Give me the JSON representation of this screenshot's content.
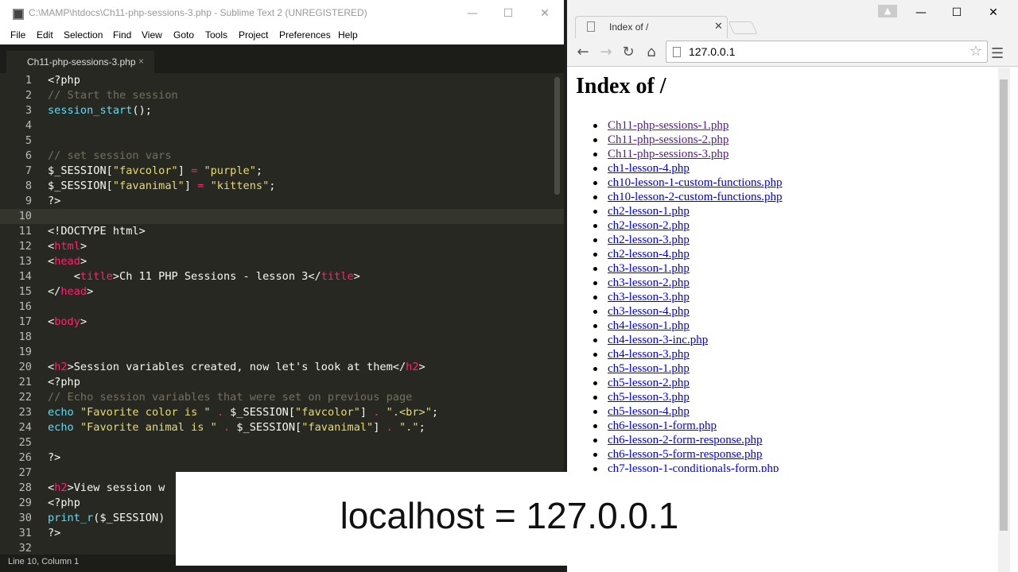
{
  "sublime": {
    "title": "C:\\MAMP\\htdocs\\Ch11-php-sessions-3.php - Sublime Text 2 (UNREGISTERED)",
    "menu": [
      "File",
      "Edit",
      "Selection",
      "Find",
      "View",
      "Goto",
      "Tools",
      "Project",
      "Preferences",
      "Help"
    ],
    "tab": "Ch11-php-sessions-3.php",
    "status": "Line 10, Column 1",
    "lines": [
      {
        "n": "1",
        "html": "&lt;?php"
      },
      {
        "n": "2",
        "html": "<span class=\"c\">// Start the session</span>"
      },
      {
        "n": "3",
        "html": "<span class=\"f\">session_start</span>();"
      },
      {
        "n": "4",
        "html": ""
      },
      {
        "n": "5",
        "html": ""
      },
      {
        "n": "6",
        "html": "<span class=\"c\">// set session vars</span>"
      },
      {
        "n": "7",
        "html": "$_SESSION[<span class=\"s\">\"favcolor\"</span>] <span class=\"k\">=</span> <span class=\"s\">\"purple\"</span>;"
      },
      {
        "n": "8",
        "html": "$_SESSION[<span class=\"s\">\"favanimal\"</span>] <span class=\"k\">=</span> <span class=\"s\">\"kittens\"</span>;"
      },
      {
        "n": "9",
        "html": "?&gt;"
      },
      {
        "n": "10",
        "html": ""
      },
      {
        "n": "11",
        "html": "&lt;!DOCTYPE html&gt;"
      },
      {
        "n": "12",
        "html": "&lt;<span class=\"k\">html</span>&gt;"
      },
      {
        "n": "13",
        "html": "&lt;<span class=\"k\">head</span>&gt;"
      },
      {
        "n": "14",
        "html": "    &lt;<span class=\"k\">title</span>&gt;Ch 11 PHP Sessions - lesson 3&lt;/<span class=\"k\">title</span>&gt;"
      },
      {
        "n": "15",
        "html": "&lt;/<span class=\"k\">head</span>&gt;"
      },
      {
        "n": "16",
        "html": ""
      },
      {
        "n": "17",
        "html": "&lt;<span class=\"k\">body</span>&gt;"
      },
      {
        "n": "18",
        "html": ""
      },
      {
        "n": "19",
        "html": ""
      },
      {
        "n": "20",
        "html": "&lt;<span class=\"k\">h2</span>&gt;Session variables created, now let's look at them&lt;/<span class=\"k\">h2</span>&gt;"
      },
      {
        "n": "21",
        "html": "&lt;?php"
      },
      {
        "n": "22",
        "html": "<span class=\"c\">// Echo session variables that were set on previous page</span>"
      },
      {
        "n": "23",
        "html": "<span class=\"f\">echo</span> <span class=\"s\">\"Favorite color is \"</span> <span class=\"k\">.</span> $_SESSION[<span class=\"s\">\"favcolor\"</span>] <span class=\"k\">.</span> <span class=\"s\">\".&lt;br&gt;\"</span>;"
      },
      {
        "n": "24",
        "html": "<span class=\"f\">echo</span> <span class=\"s\">\"Favorite animal is \"</span> <span class=\"k\">.</span> $_SESSION[<span class=\"s\">\"favanimal\"</span>] <span class=\"k\">.</span> <span class=\"s\">\".\"</span>;"
      },
      {
        "n": "25",
        "html": ""
      },
      {
        "n": "26",
        "html": "?&gt;"
      },
      {
        "n": "27",
        "html": ""
      },
      {
        "n": "28",
        "html": "&lt;<span class=\"k\">h2</span>&gt;View session w"
      },
      {
        "n": "29",
        "html": "&lt;?php"
      },
      {
        "n": "30",
        "html": "<span class=\"f\">print_r</span>($_SESSION)"
      },
      {
        "n": "31",
        "html": "?&gt;"
      },
      {
        "n": "32",
        "html": ""
      }
    ]
  },
  "chrome": {
    "tab": "Index of /",
    "url": "127.0.0.1",
    "heading": "Index of /",
    "links": [
      {
        "text": "Ch11-php-sessions-1.php",
        "visited": true
      },
      {
        "text": "Ch11-php-sessions-2.php",
        "visited": true
      },
      {
        "text": "Ch11-php-sessions-3.php",
        "visited": true
      },
      {
        "text": "ch1-lesson-4.php",
        "visited": false
      },
      {
        "text": "ch10-lesson-1-custom-functions.php",
        "visited": false
      },
      {
        "text": "ch10-lesson-2-custom-functions.php",
        "visited": false
      },
      {
        "text": "ch2-lesson-1.php",
        "visited": false
      },
      {
        "text": "ch2-lesson-2.php",
        "visited": false
      },
      {
        "text": "ch2-lesson-3.php",
        "visited": false
      },
      {
        "text": "ch2-lesson-4.php",
        "visited": false
      },
      {
        "text": "ch3-lesson-1.php",
        "visited": false
      },
      {
        "text": "ch3-lesson-2.php",
        "visited": false
      },
      {
        "text": "ch3-lesson-3.php",
        "visited": false
      },
      {
        "text": "ch3-lesson-4.php",
        "visited": false
      },
      {
        "text": "ch4-lesson-1.php",
        "visited": false
      },
      {
        "text": "ch4-lesson-3-inc.php",
        "visited": false
      },
      {
        "text": "ch4-lesson-3.php",
        "visited": false
      },
      {
        "text": "ch5-lesson-1.php",
        "visited": false
      },
      {
        "text": "ch5-lesson-2.php",
        "visited": false
      },
      {
        "text": "ch5-lesson-3.php",
        "visited": false
      },
      {
        "text": "ch5-lesson-4.php",
        "visited": false
      },
      {
        "text": "ch6-lesson-1-form.php",
        "visited": false
      },
      {
        "text": "ch6-lesson-2-form-response.php",
        "visited": false
      },
      {
        "text": "ch6-lesson-5-form-response.php",
        "visited": false
      },
      {
        "text": "ch7-lesson-1-conditionals-form.php",
        "visited": false
      }
    ]
  },
  "overlay": {
    "caption": "localhost = 127.0.0.1"
  }
}
